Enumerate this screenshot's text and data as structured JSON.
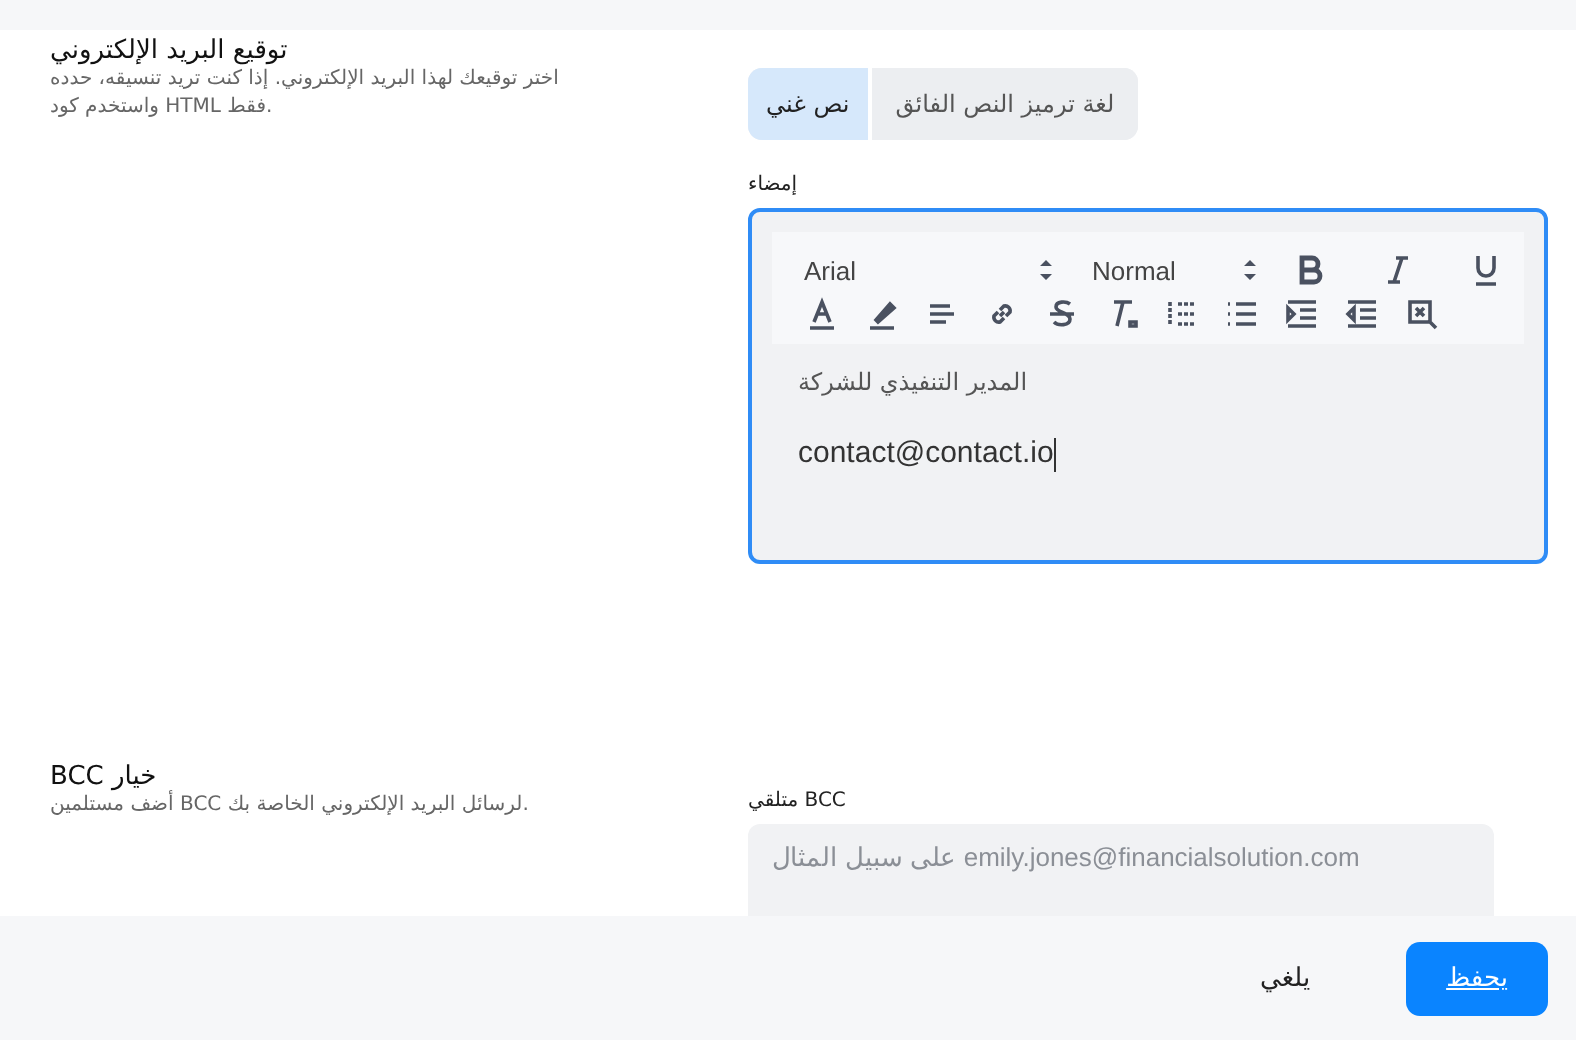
{
  "signature_section": {
    "title": "توقيع البريد الإلكتروني",
    "description": "اختر توقيعك لهذا البريد الإلكتروني. إذا كنت تريد تنسيقه، حدده واستخدم كود HTML فقط.",
    "tabs": [
      {
        "label": "لغة ترميز النص الفائق",
        "selected": false
      },
      {
        "label": "نص غني",
        "selected": true
      }
    ],
    "editor": {
      "label": "إمضاء",
      "font": "Arial",
      "size": "Normal",
      "lines": [
        "المدير التنفيذي للشركة",
        "contact@contact.io"
      ]
    }
  },
  "bcc_section": {
    "title": "BCC خيار",
    "description": "أضف مستلمين BCC لرسائل البريد الإلكتروني الخاصة بك.",
    "field_label": "متلقي BCC",
    "placeholder": "على سبيل المثال emily.jones@financialsolution.com"
  },
  "buttons": [
    {
      "label": "يحفظ",
      "kind": "primary"
    },
    {
      "label": "يلغي",
      "kind": "secondary"
    }
  ]
}
